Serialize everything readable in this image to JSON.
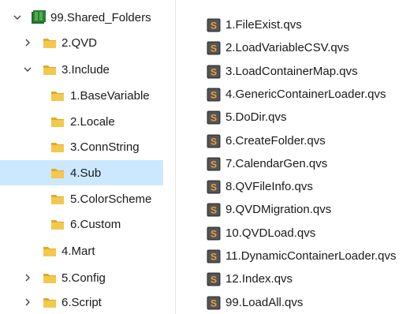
{
  "tree": {
    "root": {
      "label": "99.Shared_Folders",
      "icon": "shared-folder-icon",
      "expanded": true
    },
    "nodes": [
      {
        "label": "2.QVD",
        "expanded": false,
        "has_children": true,
        "selected": false
      },
      {
        "label": "3.Include",
        "expanded": true,
        "has_children": true,
        "selected": false
      },
      {
        "label": "1.BaseVariable",
        "expanded": false,
        "has_children": false,
        "selected": false
      },
      {
        "label": "2.Locale",
        "expanded": false,
        "has_children": false,
        "selected": false
      },
      {
        "label": "3.ConnString",
        "expanded": false,
        "has_children": false,
        "selected": false
      },
      {
        "label": "4.Sub",
        "expanded": false,
        "has_children": false,
        "selected": true
      },
      {
        "label": "5.ColorScheme",
        "expanded": false,
        "has_children": false,
        "selected": false
      },
      {
        "label": "6.Custom",
        "expanded": false,
        "has_children": false,
        "selected": false
      },
      {
        "label": "4.Mart",
        "expanded": false,
        "has_children": false,
        "selected": false
      },
      {
        "label": "5.Config",
        "expanded": false,
        "has_children": true,
        "selected": false
      },
      {
        "label": "6.Script",
        "expanded": false,
        "has_children": true,
        "selected": false
      }
    ]
  },
  "files": [
    {
      "name": "1.FileExist.qvs",
      "icon": "qvs-script-icon"
    },
    {
      "name": "2.LoadVariableCSV.qvs",
      "icon": "qvs-script-icon"
    },
    {
      "name": "3.LoadContainerMap.qvs",
      "icon": "qvs-script-icon"
    },
    {
      "name": "4.GenericContainerLoader.qvs",
      "icon": "qvs-script-icon"
    },
    {
      "name": "5.DoDir.qvs",
      "icon": "qvs-script-icon"
    },
    {
      "name": "6.CreateFolder.qvs",
      "icon": "qvs-script-icon"
    },
    {
      "name": "7.CalendarGen.qvs",
      "icon": "qvs-script-icon"
    },
    {
      "name": "8.QVFileInfo.qvs",
      "icon": "qvs-script-icon"
    },
    {
      "name": "9.QVDMigration.qvs",
      "icon": "qvs-script-icon"
    },
    {
      "name": "10.QVDLoad.qvs",
      "icon": "qvs-script-icon"
    },
    {
      "name": "11.DynamicContainerLoader.qvs",
      "icon": "qvs-script-icon"
    },
    {
      "name": "12.Index.qvs",
      "icon": "qvs-script-icon"
    },
    {
      "name": "99.LoadAll.qvs",
      "icon": "qvs-script-icon"
    }
  ],
  "colors": {
    "folder": "#f2c94c",
    "folder_dark": "#e0a92a",
    "selection": "#cce8ff",
    "shared_folder": "#2e7d32",
    "chevron": "#444444",
    "qvs_icon_bg": "#3b3b3b",
    "qvs_icon_accent": "#e8a33d"
  }
}
